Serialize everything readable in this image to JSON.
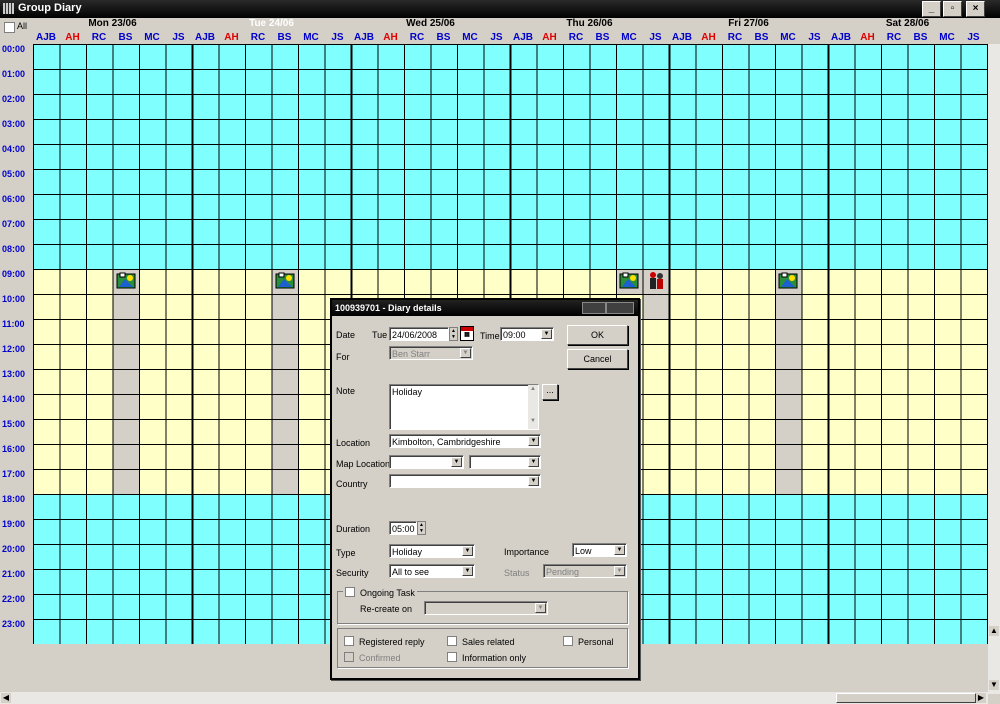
{
  "window": {
    "title": "Group Diary",
    "min": "_",
    "max": "▫",
    "close": "×"
  },
  "header": {
    "all_label": "All",
    "days": [
      {
        "label": "Mon 23/06",
        "selected": false
      },
      {
        "label": "Tue 24/06",
        "selected": true
      },
      {
        "label": "Wed 25/06",
        "selected": false
      },
      {
        "label": "Thu 26/06",
        "selected": false
      },
      {
        "label": "Fri 27/06",
        "selected": false
      },
      {
        "label": "Sat 28/06",
        "selected": false
      }
    ],
    "people": [
      "AJB",
      "AH",
      "RC",
      "BS",
      "MC",
      "JS"
    ],
    "red_people": [
      "AH"
    ]
  },
  "times": [
    "00:00",
    "01:00",
    "02:00",
    "03:00",
    "04:00",
    "05:00",
    "06:00",
    "07:00",
    "08:00",
    "09:00",
    "10:00",
    "11:00",
    "12:00",
    "13:00",
    "14:00",
    "15:00",
    "16:00",
    "17:00",
    "18:00",
    "19:00",
    "20:00",
    "21:00",
    "22:00",
    "23:00"
  ],
  "work_hours": {
    "start": 9,
    "end": 18
  },
  "colors": {
    "offhours": "#80ffff",
    "workhours": "#ffffc8",
    "booked": "#d4d0c8",
    "header_initials": "#0000cc",
    "header_red": "#e00000"
  },
  "events": [
    {
      "day": 0,
      "person": 3,
      "start": 9,
      "end": 18,
      "icon": "holiday-icon"
    },
    {
      "day": 1,
      "person": 3,
      "start": 9,
      "end": 18,
      "icon": "holiday-icon"
    },
    {
      "day": 3,
      "person": 4,
      "start": 9,
      "end": 10,
      "icon": "holiday-icon"
    },
    {
      "day": 3,
      "person": 5,
      "start": 9,
      "end": 11,
      "icon": "meeting-icon"
    },
    {
      "day": 4,
      "person": 4,
      "start": 9,
      "end": 18,
      "icon": "holiday-icon"
    }
  ],
  "dialog": {
    "title": "100939701 - Diary details",
    "date_label": "Date",
    "date_day": "Tue",
    "date_value": "24/06/2008",
    "time_label": "Time",
    "time_value": "09:00",
    "ok": "OK",
    "cancel": "Cancel",
    "for_label": "For",
    "for_value": "Ben Starr",
    "note_label": "Note",
    "note_value": "Holiday",
    "note_more": "...",
    "location_label": "Location",
    "location_value": "Kimbolton, Cambridgeshire",
    "map_location_label": "Map Location",
    "map_location_value1": "",
    "map_location_value2": "",
    "country_label": "Country",
    "country_value": "",
    "duration_label": "Duration",
    "duration_value": "05:00",
    "type_label": "Type",
    "type_value": "Holiday",
    "importance_label": "Importance",
    "importance_value": "Low",
    "security_label": "Security",
    "security_value": "All to see",
    "status_label": "Status",
    "status_value": "Pending",
    "ongoing_label": "Ongoing Task",
    "recreate_label": "Re-create on",
    "recreate_value": "",
    "registered_reply": "Registered reply",
    "sales_related": "Sales related",
    "personal": "Personal",
    "confirmed": "Confirmed",
    "information_only": "Information only"
  }
}
